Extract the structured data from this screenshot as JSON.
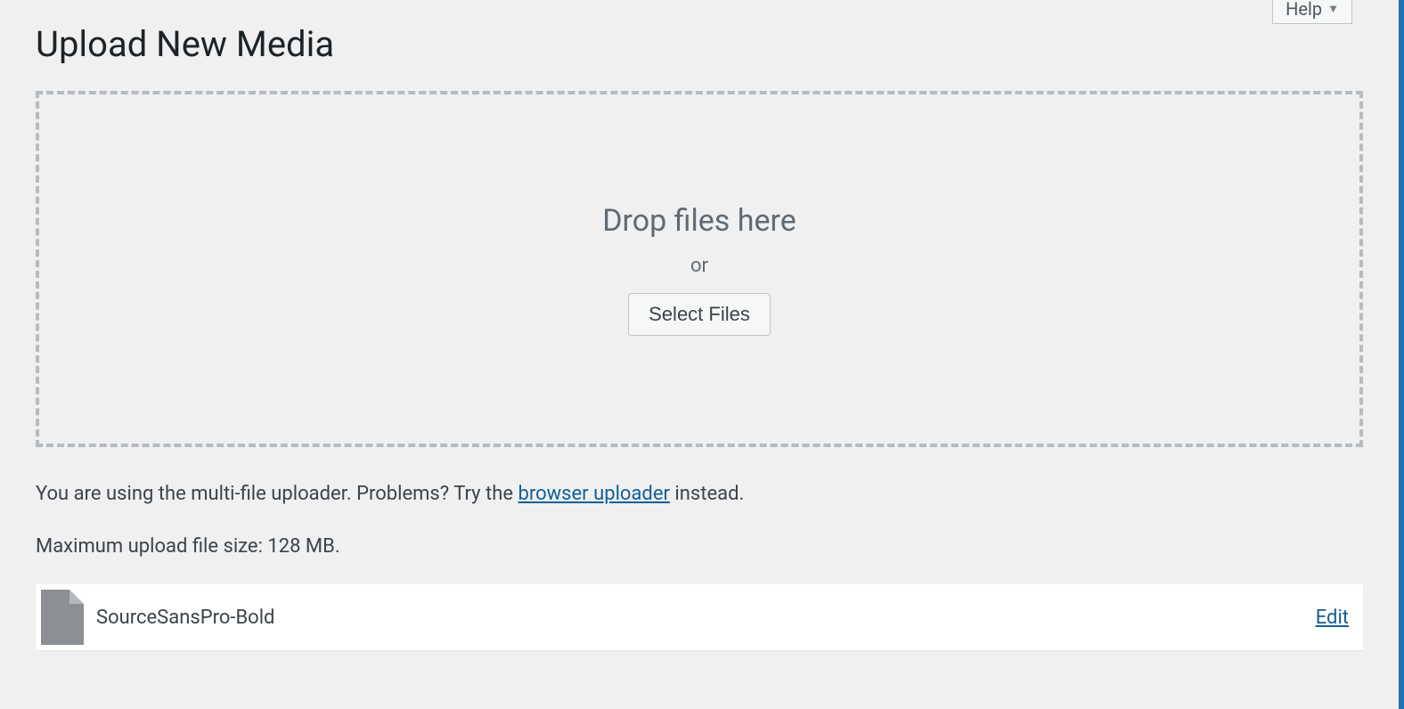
{
  "header": {
    "help_label": "Help",
    "page_title": "Upload New Media"
  },
  "uploader": {
    "drop_text": "Drop files here",
    "or_text": "or",
    "select_files_label": "Select Files"
  },
  "notes": {
    "multi_uploader_prefix": "You are using the multi-file uploader. Problems? Try the ",
    "browser_uploader_link": "browser uploader",
    "multi_uploader_suffix": " instead.",
    "max_size": "Maximum upload file size: 128 MB."
  },
  "media_items": [
    {
      "name": "SourceSansPro-Bold",
      "edit_label": "Edit"
    }
  ]
}
